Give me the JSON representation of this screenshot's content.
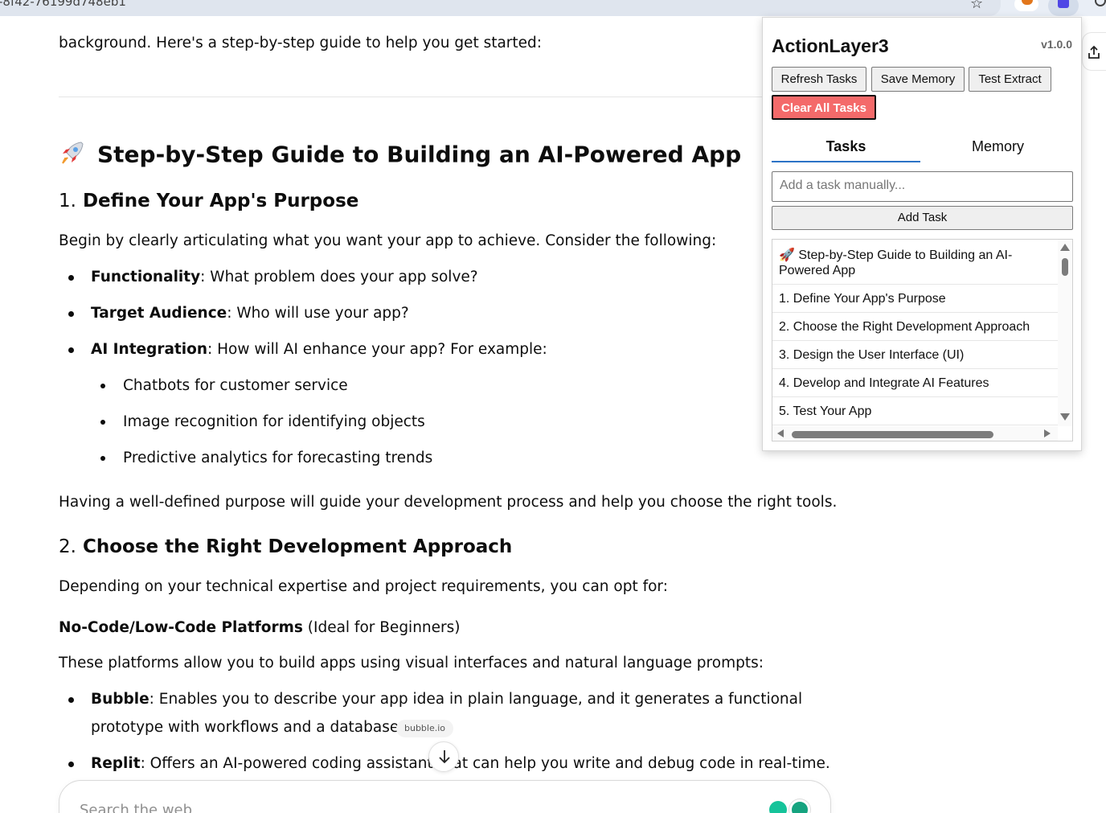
{
  "browser": {
    "url_fragment": "-8f42-76199d748eb1"
  },
  "article": {
    "intro_tail": "background. Here's a step-by-step guide to help you get started:",
    "main_heading": "Step-by-Step Guide to Building an AI-Powered App",
    "section1": {
      "number": "1.",
      "title": "Define Your App's Purpose",
      "intro": "Begin by clearly articulating what you want your app to achieve. Consider the following:",
      "items": [
        {
          "bold": "Functionality",
          "text": ": What problem does your app solve?"
        },
        {
          "bold": "Target Audience",
          "text": ": Who will use your app?"
        },
        {
          "bold": "AI Integration",
          "text": ": How will AI enhance your app? For example:"
        }
      ],
      "sub_items": [
        "Chatbots for customer service",
        "Image recognition for identifying objects",
        "Predictive analytics for forecasting trends"
      ],
      "outro": "Having a well-defined purpose will guide your development process and help you choose the right tools."
    },
    "section2": {
      "number": "2.",
      "title": "Choose the Right Development Approach",
      "intro": "Depending on your technical expertise and project requirements, you can opt for:",
      "subheading_bold": "No-Code/Low-Code Platforms",
      "subheading_rest": " (Ideal for Beginners)",
      "platforms_intro": "These platforms allow you to build apps using visual interfaces and natural language prompts:",
      "items": [
        {
          "bold": "Bubble",
          "text": ": Enables you to describe your app idea in plain language, and it generates a functional",
          "text2": "prototype with workflows and a database."
        },
        {
          "bold": "Replit",
          "text": ": Offers an AI-powered coding assistant that can help you write and debug code in real-time."
        }
      ],
      "citation": "bubble.io"
    }
  },
  "search": {
    "placeholder": "Search the web"
  },
  "extension": {
    "title": "ActionLayer3",
    "version": "v1.0.0",
    "buttons": {
      "refresh": "Refresh Tasks",
      "save_memory": "Save Memory",
      "test_extract": "Test Extract",
      "clear_all": "Clear All Tasks"
    },
    "tabs": [
      "Tasks",
      "Memory"
    ],
    "active_tab": "Tasks",
    "input_placeholder": "Add a task manually...",
    "add_button": "Add Task",
    "tasks": [
      {
        "line1": "🚀 Step-by-Step Guide to Building an AI-",
        "line2": "Powered App"
      },
      {
        "line1": "1. Define Your App's Purpose",
        "line2": ""
      },
      {
        "line1": "2. Choose the Right Development Approach",
        "line2": ""
      },
      {
        "line1": "3. Design the User Interface (UI)",
        "line2": ""
      },
      {
        "line1": "4. Develop and Integrate AI Features",
        "line2": ""
      },
      {
        "line1": "5. Test Your App",
        "line2": ""
      }
    ]
  },
  "colors": {
    "accent_tab": "#2b73c6",
    "danger_button": "#f46a6a"
  }
}
